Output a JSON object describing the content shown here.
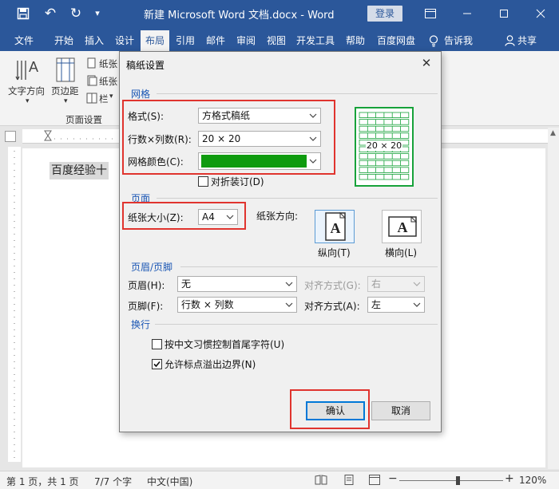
{
  "window": {
    "title": "新建 Microsoft Word 文档.docx  -  Word",
    "login_label": "登录",
    "undo_glyph": "↶",
    "redo_glyph": "↻",
    "qa_dropdown_glyph": "▾"
  },
  "menu": {
    "tabs": [
      "文件",
      "开始",
      "插入",
      "设计",
      "布局",
      "引用",
      "邮件",
      "审阅",
      "视图",
      "开发工具",
      "帮助",
      "百度网盘"
    ],
    "active": "布局",
    "tell_me": "告诉我",
    "share": "共享"
  },
  "ribbon": {
    "text_direction": "文字方向",
    "margins": "页边距",
    "paper1": "纸张",
    "paper2": "纸张",
    "columns": "栏",
    "group_name": "页面设置"
  },
  "document": {
    "text": "百度经验十"
  },
  "status": {
    "page": "第 1 页，共 1 页",
    "words": "7/7 个字",
    "language": "中文(中国)",
    "zoom": "120%",
    "zoom_minus": "−",
    "zoom_plus": "+"
  },
  "dialog": {
    "title": "稿纸设置",
    "close_glyph": "✕",
    "grid": {
      "section": "网格",
      "format_label": "格式(S):",
      "format_value": "方格式稿纸",
      "rowcol_label": "行数×列数(R):",
      "rowcol_value": "20 × 20",
      "color_label": "网格颜色(C):",
      "color_value": "#0f9b0f",
      "binding_label": "对折装订(D)",
      "binding_checked": false,
      "preview_text": "20 × 20"
    },
    "page": {
      "section": "页面",
      "size_label": "纸张大小(Z):",
      "size_value": "A4",
      "orientation_label": "纸张方向:",
      "portrait_label": "纵向(T)",
      "landscape_label": "横向(L)",
      "letter": "A",
      "selected_orientation": "portrait"
    },
    "header_footer": {
      "section": "页眉/页脚",
      "header_label": "页眉(H):",
      "header_value": "无",
      "header_align_label": "对齐方式(G):",
      "header_align_value": "右",
      "footer_label": "页脚(F):",
      "footer_value": "行数 × 列数",
      "footer_align_label": "对齐方式(A):",
      "footer_align_value": "左"
    },
    "line_break": {
      "section": "换行",
      "option1_label": "按中文习惯控制首尾字符(U)",
      "option1_checked": false,
      "option2_label": "允许标点溢出边界(N)",
      "option2_checked": true
    },
    "ok_label": "确认",
    "cancel_label": "取消"
  },
  "colors": {
    "brand": "#2b579a",
    "highlight": "#e0342e",
    "grid_green": "#17a23a"
  }
}
